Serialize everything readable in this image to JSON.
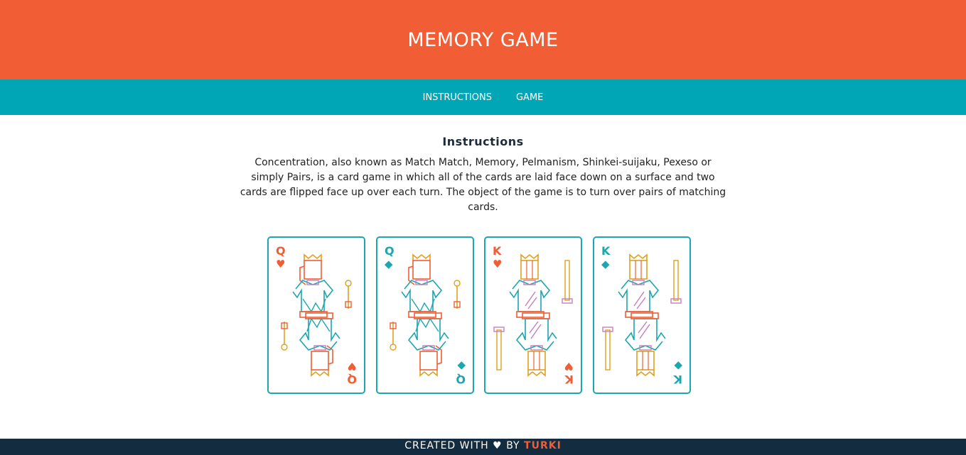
{
  "header": {
    "title": "MEMORY GAME"
  },
  "nav": {
    "items": [
      {
        "label": "INSTRUCTIONS"
      },
      {
        "label": "GAME"
      }
    ]
  },
  "instructions": {
    "heading": "Instructions",
    "body": "Concentration, also known as Match Match, Memory, Pelmanism, Shinkei-suijaku, Pexeso or simply Pairs, is a card game in which all of the cards are laid face down on a surface and two cards are flipped face up over each turn. The object of the game is to turn over pairs of matching cards."
  },
  "cards": [
    {
      "rank": "Q",
      "suit": "♥",
      "suit_name": "hearts",
      "suit_color": "#f15d34"
    },
    {
      "rank": "Q",
      "suit": "◆",
      "suit_name": "diamonds",
      "suit_color": "#1ba6b0"
    },
    {
      "rank": "K",
      "suit": "♥",
      "suit_name": "hearts",
      "suit_color": "#f15d34"
    },
    {
      "rank": "K",
      "suit": "◆",
      "suit_name": "diamonds",
      "suit_color": "#1ba6b0"
    }
  ],
  "footer": {
    "prefix": "CREATED WITH",
    "heart": "♥",
    "by": "BY",
    "author": "TURKI"
  },
  "colors": {
    "header": "#f15d34",
    "nav": "#00a6b5",
    "footer": "#132c3f",
    "card_border": "#1ba6b0"
  }
}
